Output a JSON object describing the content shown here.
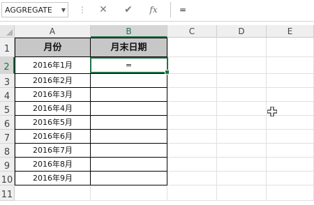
{
  "formula_bar": {
    "namebox": "AGGREGATE",
    "dropdown_glyph": "▼",
    "separator": "⋮",
    "cancel_glyph": "✕",
    "enter_glyph": "✔",
    "fx_label": "fx",
    "formula": "="
  },
  "sheet": {
    "columns": [
      "A",
      "B",
      "C",
      "D",
      "E"
    ],
    "rows": [
      "1",
      "2",
      "3",
      "4",
      "5",
      "6",
      "7",
      "8",
      "9",
      "10",
      "11"
    ],
    "active_cell": "B2",
    "header_row": {
      "a": "月份",
      "b": "月末日期"
    },
    "data": [
      {
        "a": "2016年1月",
        "b": "="
      },
      {
        "a": "2016年2月",
        "b": ""
      },
      {
        "a": "2016年3月",
        "b": ""
      },
      {
        "a": "2016年4月",
        "b": ""
      },
      {
        "a": "2016年5月",
        "b": ""
      },
      {
        "a": "2016年6月",
        "b": ""
      },
      {
        "a": "2016年7月",
        "b": ""
      },
      {
        "a": "2016年8月",
        "b": ""
      },
      {
        "a": "2016年9月",
        "b": ""
      }
    ]
  },
  "colors": {
    "accent": "#217346",
    "header_fill": "#c7c7c7"
  }
}
